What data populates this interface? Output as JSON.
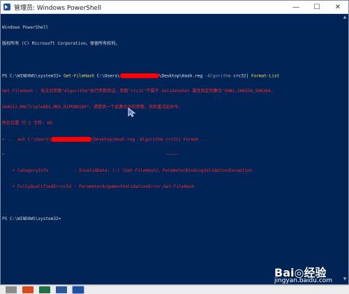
{
  "window": {
    "title": "管理员: Windows PowerShell",
    "controls": {
      "minimize": "—",
      "maximize": "☐",
      "close": "✕"
    }
  },
  "console": {
    "header_line1": "Windows PowerShell",
    "header_line2": "版权所有 (C) Microsoft Corporation。保留所有权利。",
    "prompt1": "PS C:\\WINDOWS\\system32> ",
    "cmd": "Get-FileHash",
    "cmd_arg_prefix": " C:\\Users\\",
    "cmd_arg_suffix": "\\Desktop\\Hash.reg ",
    "param1": "-Algorithm",
    "algo": " crc32",
    "pipe": "| ",
    "cmd2": "Format-List",
    "err1": "Get-FileHash : 无法对参数\"Algorithm\"执行参数验证。参数\"crc32\"不属于 ValidateSet 属性指定的集合\"SHA1,SHA256,SHA384,",
    "err2": "SHA512,MACTripleDES,MD5,RIPEMD160\"。请提供一个此集合中的参数，然后重试此命令。",
    "err3": "所在位置 行:1 字符: 66",
    "err4_prefix": "+ ... ash C:\\Users\\",
    "err4_suffix": "\\Desktop\\Hash.reg -Algorithm crc32| Format ...",
    "err5": "+                                                               ~~~~~",
    "err6": "    + CategoryInfo          : InvalidData: (:) [Get-FileHash]，ParameterBindingValidationException",
    "err7": "    + FullyQualifiedErrorId : ParameterArgumentValidationError,Get-FileHash",
    "prompt2": "PS C:\\WINDOWS\\system32>"
  },
  "scrollbar": {
    "up": "▲",
    "down": "▼"
  },
  "watermark": {
    "main": "Bai◎经验",
    "sub": "jingyan.baidu.com"
  },
  "taskbar": {
    "items": [
      "app-1",
      "app-2",
      "app-3",
      "app-4",
      "powershell"
    ]
  },
  "colors": {
    "console_bg": "#012456",
    "error_text": "#ff2b2b",
    "command_text": "#f2e64c",
    "redaction": "#ff0000"
  }
}
